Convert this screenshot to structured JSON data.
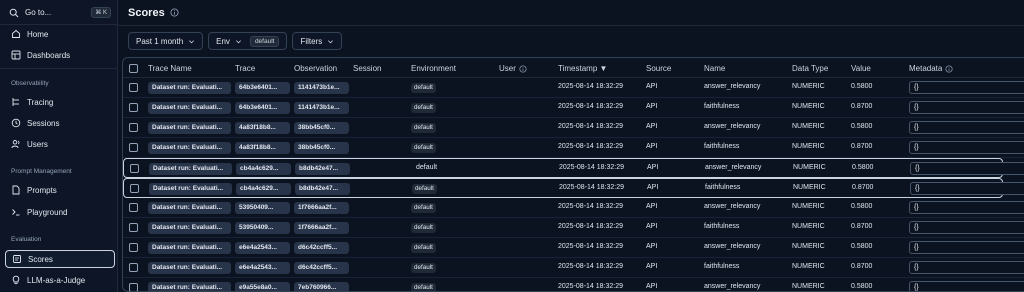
{
  "sidebar": {
    "goto": {
      "label": "Go to...",
      "shortcut": "⌘ K"
    },
    "items_top": [
      {
        "label": "Home",
        "icon": "home-icon"
      },
      {
        "label": "Dashboards",
        "icon": "dashboard-icon"
      }
    ],
    "sections": [
      {
        "title": "Observability",
        "items": [
          {
            "label": "Tracing",
            "icon": "tracing-icon"
          },
          {
            "label": "Sessions",
            "icon": "clock-icon"
          },
          {
            "label": "Users",
            "icon": "users-icon"
          }
        ]
      },
      {
        "title": "Prompt Management",
        "items": [
          {
            "label": "Prompts",
            "icon": "file-icon"
          },
          {
            "label": "Playground",
            "icon": "terminal-icon"
          }
        ]
      },
      {
        "title": "Evaluation",
        "items": [
          {
            "label": "Scores",
            "icon": "scores-icon",
            "active": true
          },
          {
            "label": "LLM-as-a-Judge",
            "icon": "lightbulb-icon"
          }
        ]
      }
    ]
  },
  "header": {
    "title": "Scores"
  },
  "toolbar": {
    "date_range": "Past 1 month",
    "env_label": "Env",
    "env_value": "default",
    "filters": "Filters"
  },
  "table": {
    "columns": [
      "Trace Name",
      "Trace",
      "Observation",
      "Session",
      "Environment",
      "User",
      "Timestamp ▼",
      "Source",
      "Name",
      "Data Type",
      "Value",
      "Metadata"
    ],
    "rows": [
      {
        "trace_name": "Dataset run: Evaluati...",
        "trace": "64b3e6401...",
        "observation": "1141473b1e...",
        "environment": "default",
        "timestamp": "2025-08-14 18:32:29",
        "source": "API",
        "name": "answer_relevancy",
        "data_type": "NUMERIC",
        "value": "0.5800",
        "metadata": "{}",
        "selected": false,
        "badged": true
      },
      {
        "trace_name": "Dataset run: Evaluati...",
        "trace": "64b3e6401...",
        "observation": "1141473b1e...",
        "environment": "default",
        "timestamp": "2025-08-14 18:32:29",
        "source": "API",
        "name": "faithfulness",
        "data_type": "NUMERIC",
        "value": "0.8700",
        "metadata": "{}",
        "selected": false,
        "badged": true
      },
      {
        "trace_name": "Dataset run: Evaluati...",
        "trace": "4a83f18b8...",
        "observation": "38bb45cf0...",
        "environment": "default",
        "timestamp": "2025-08-14 18:32:29",
        "source": "API",
        "name": "answer_relevancy",
        "data_type": "NUMERIC",
        "value": "0.5800",
        "metadata": "{}",
        "selected": false,
        "badged": true
      },
      {
        "trace_name": "Dataset run: Evaluati...",
        "trace": "4a83f18b8...",
        "observation": "38bb45cf0...",
        "environment": "default",
        "timestamp": "2025-08-14 18:32:29",
        "source": "API",
        "name": "faithfulness",
        "data_type": "NUMERIC",
        "value": "0.8700",
        "metadata": "{}",
        "selected": false,
        "badged": true
      },
      {
        "trace_name": "Dataset run: Evaluati...",
        "trace": "cb4a4c629...",
        "observation": "b8db42e47...",
        "environment": "default",
        "timestamp": "2025-08-14 18:32:29",
        "source": "API",
        "name": "answer_relevancy",
        "data_type": "NUMERIC",
        "value": "0.5800",
        "metadata": "{}",
        "selected": true,
        "badged": false
      },
      {
        "trace_name": "Dataset run: Evaluati...",
        "trace": "cb4a4c629...",
        "observation": "b8db42e47...",
        "environment": "default",
        "timestamp": "2025-08-14 18:32:29",
        "source": "API",
        "name": "faithfulness",
        "data_type": "NUMERIC",
        "value": "0.8700",
        "metadata": "{}",
        "selected": true,
        "badged": true
      },
      {
        "trace_name": "Dataset run: Evaluati...",
        "trace": "53950409...",
        "observation": "1f7666aa2f...",
        "environment": "default",
        "timestamp": "2025-08-14 18:32:29",
        "source": "API",
        "name": "answer_relevancy",
        "data_type": "NUMERIC",
        "value": "0.5800",
        "metadata": "{}",
        "selected": false,
        "badged": true
      },
      {
        "trace_name": "Dataset run: Evaluati...",
        "trace": "53950409...",
        "observation": "1f7666aa2f...",
        "environment": "default",
        "timestamp": "2025-08-14 18:32:29",
        "source": "API",
        "name": "faithfulness",
        "data_type": "NUMERIC",
        "value": "0.8700",
        "metadata": "{}",
        "selected": false,
        "badged": true
      },
      {
        "trace_name": "Dataset run: Evaluati...",
        "trace": "e6e4a2543...",
        "observation": "d6c42ccff5...",
        "environment": "default",
        "timestamp": "2025-08-14 18:32:29",
        "source": "API",
        "name": "answer_relevancy",
        "data_type": "NUMERIC",
        "value": "0.5800",
        "metadata": "{}",
        "selected": false,
        "badged": true
      },
      {
        "trace_name": "Dataset run: Evaluati...",
        "trace": "e6e4a2543...",
        "observation": "d6c42ccff5...",
        "environment": "default",
        "timestamp": "2025-08-14 18:32:29",
        "source": "API",
        "name": "faithfulness",
        "data_type": "NUMERIC",
        "value": "0.8700",
        "metadata": "{}",
        "selected": false,
        "badged": true
      },
      {
        "trace_name": "Dataset run: Evaluati...",
        "trace": "e9a55e8a0...",
        "observation": "7eb760966...",
        "environment": "default",
        "timestamp": "2025-08-14 18:32:29",
        "source": "API",
        "name": "answer_relevancy",
        "data_type": "NUMERIC",
        "value": "0.5800",
        "metadata": "{}",
        "selected": false,
        "badged": true
      }
    ]
  },
  "colors": {
    "background": "#0b1220",
    "sidebar": "#0d1526",
    "border": "#334155",
    "pill": "#283449",
    "selected_border": "#cbd5e1"
  }
}
